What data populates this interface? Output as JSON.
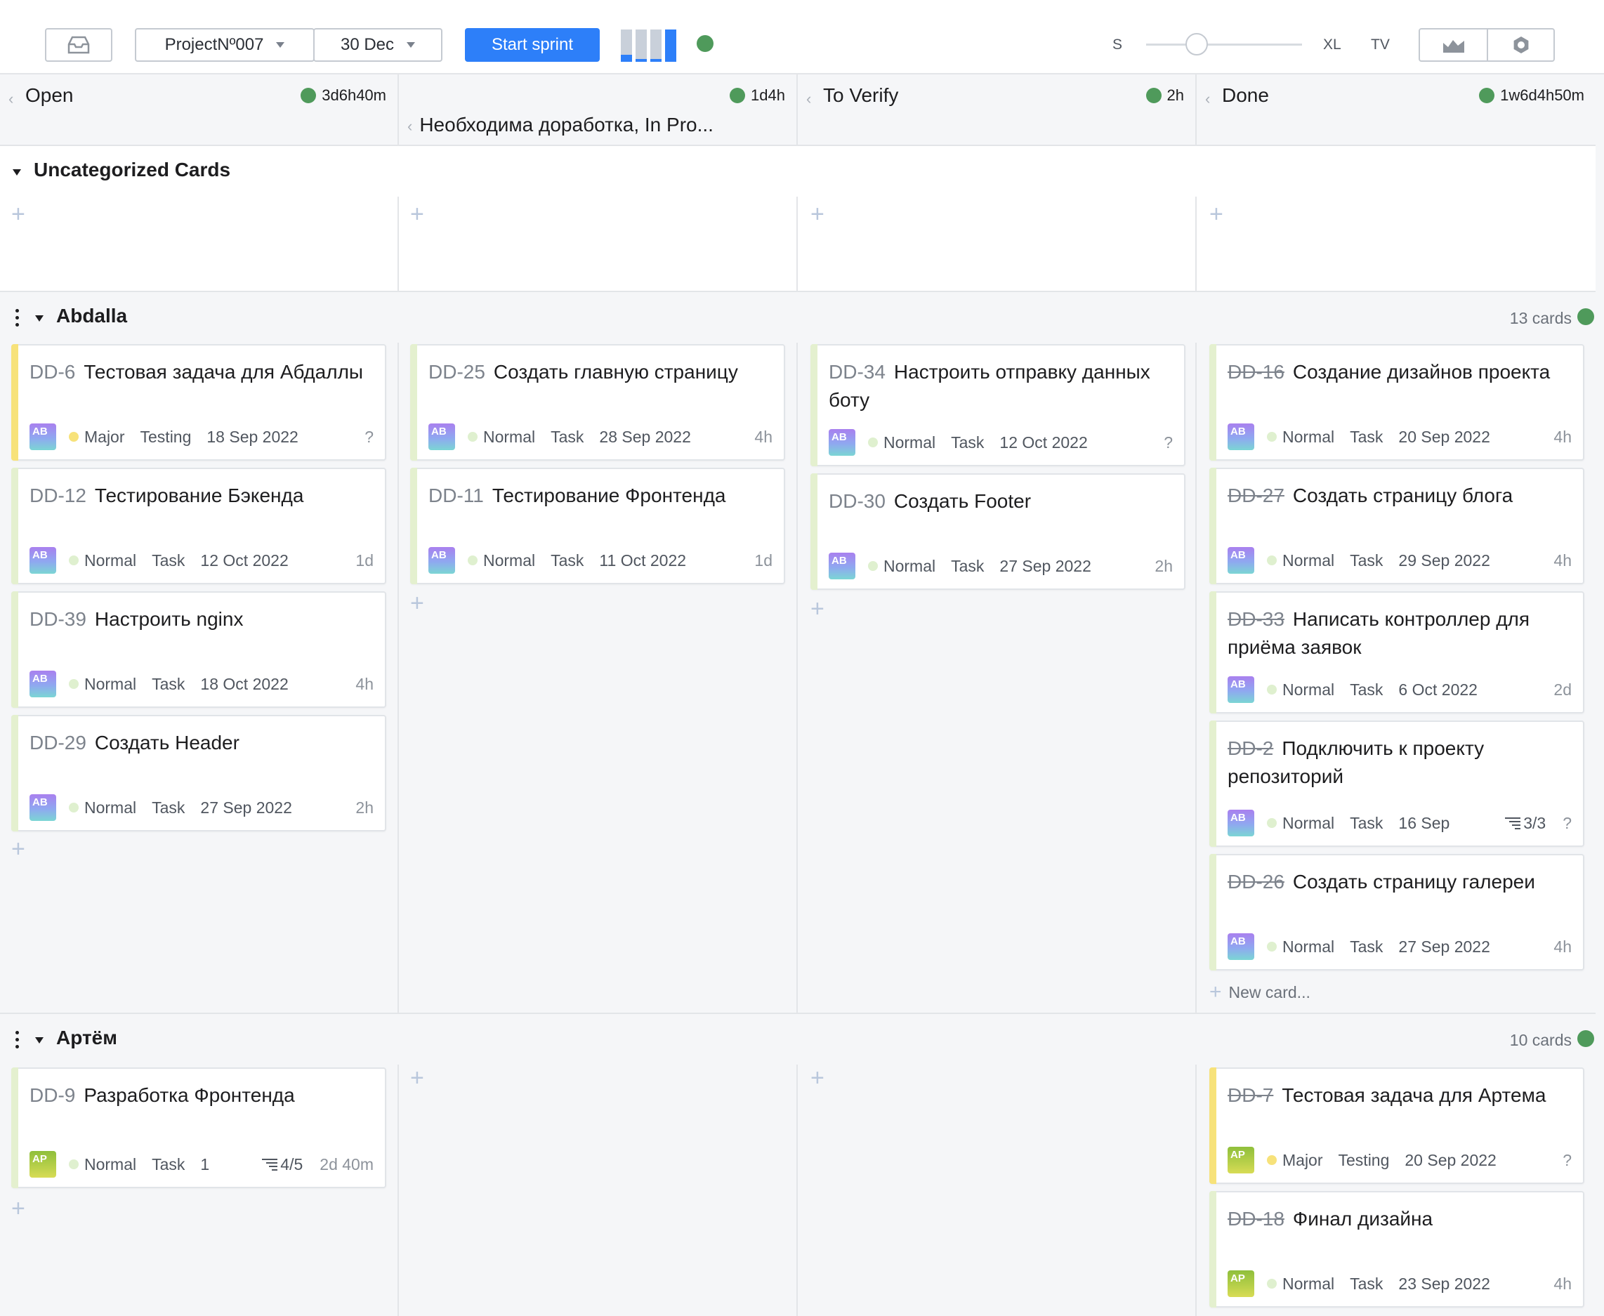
{
  "toolbar": {
    "project_label": "ProjectNº007",
    "date_label": "30 Dec",
    "start_sprint_label": "Start sprint",
    "size_small_label": "S",
    "size_large_label": "XL",
    "tv_label": "TV",
    "accent_color": "#2d7ff9",
    "status_color": "#4f9a5b"
  },
  "columns": [
    {
      "title": "Open",
      "time": "3d6h40m"
    },
    {
      "title": "Необходима доработка, In Pro...",
      "time": "1d4h"
    },
    {
      "title": "To Verify",
      "time": "2h"
    },
    {
      "title": "Done",
      "time": "1w6d4h50m"
    }
  ],
  "lanes": {
    "uncategorized": {
      "title": "Uncategorized Cards"
    },
    "abdalla": {
      "title": "Abdalla",
      "count": "13 cards"
    },
    "artem": {
      "title": "Артём",
      "count": "10 cards"
    }
  },
  "new_card_label": "New card...",
  "cards": {
    "dd6": {
      "key": "DD-6",
      "title": "Тестовая задача для Абдаллы",
      "avatar": "AB",
      "priority": "Major",
      "type": "Testing",
      "date": "18 Sep 2022",
      "estimate": "?"
    },
    "dd12": {
      "key": "DD-12",
      "title": "Тестирование Бэкенда",
      "avatar": "AB",
      "priority": "Normal",
      "type": "Task",
      "date": "12 Oct 2022",
      "estimate": "1d"
    },
    "dd39": {
      "key": "DD-39",
      "title": "Настроить nginx",
      "avatar": "AB",
      "priority": "Normal",
      "type": "Task",
      "date": "18 Oct 2022",
      "estimate": "4h"
    },
    "dd29": {
      "key": "DD-29",
      "title": "Создать Header",
      "avatar": "AB",
      "priority": "Normal",
      "type": "Task",
      "date": "27 Sep 2022",
      "estimate": "2h"
    },
    "dd25": {
      "key": "DD-25",
      "title": "Создать главную страницу",
      "avatar": "AB",
      "priority": "Normal",
      "type": "Task",
      "date": "28 Sep 2022",
      "estimate": "4h"
    },
    "dd11": {
      "key": "DD-11",
      "title": "Тестирование Фронтенда",
      "avatar": "AB",
      "priority": "Normal",
      "type": "Task",
      "date": "11 Oct 2022",
      "estimate": "1d"
    },
    "dd34": {
      "key": "DD-34",
      "title": "Настроить отправку данных боту",
      "avatar": "AB",
      "priority": "Normal",
      "type": "Task",
      "date": "12 Oct 2022",
      "estimate": "?"
    },
    "dd30": {
      "key": "DD-30",
      "title": "Создать Footer",
      "avatar": "AB",
      "priority": "Normal",
      "type": "Task",
      "date": "27 Sep 2022",
      "estimate": "2h"
    },
    "dd16": {
      "key": "DD-16",
      "title": "Создание дизайнов проекта",
      "avatar": "AB",
      "priority": "Normal",
      "type": "Task",
      "date": "20 Sep 2022",
      "estimate": "4h"
    },
    "dd27": {
      "key": "DD-27",
      "title": "Создать страницу блога",
      "avatar": "AB",
      "priority": "Normal",
      "type": "Task",
      "date": "29 Sep 2022",
      "estimate": "4h"
    },
    "dd33": {
      "key": "DD-33",
      "title": "Написать контроллер для приёма заявок",
      "avatar": "AB",
      "priority": "Normal",
      "type": "Task",
      "date": "6 Oct 2022",
      "estimate": "2d"
    },
    "dd2": {
      "key": "DD-2",
      "title": "Подключить к проекту репозиторий",
      "avatar": "AB",
      "priority": "Normal",
      "type": "Task",
      "date": "16 Sep",
      "checklist": "3/3",
      "estimate": "?"
    },
    "dd26": {
      "key": "DD-26",
      "title": "Создать страницу галереи",
      "avatar": "AB",
      "priority": "Normal",
      "type": "Task",
      "date": "27 Sep 2022",
      "estimate": "4h"
    },
    "dd9": {
      "key": "DD-9",
      "title": "Разработка Фронтенда",
      "avatar": "AP",
      "priority": "Normal",
      "type": "Task",
      "date": "1",
      "checklist": "4/5",
      "estimate": "2d 40m"
    },
    "dd7": {
      "key": "DD-7",
      "title": "Тестовая задача для Артема",
      "avatar": "AP",
      "priority": "Major",
      "type": "Testing",
      "date": "20 Sep 2022",
      "estimate": "?"
    },
    "dd18": {
      "key": "DD-18",
      "title": "Финал дизайна",
      "avatar": "AP",
      "priority": "Normal",
      "type": "Task",
      "date": "23 Sep 2022",
      "estimate": "4h"
    }
  },
  "colors": {
    "major_stripe": "#f7e27a",
    "normal_stripe": "#e4f0cf",
    "major_dot": "#f7e27a",
    "normal_dot": "#dff0cf"
  }
}
